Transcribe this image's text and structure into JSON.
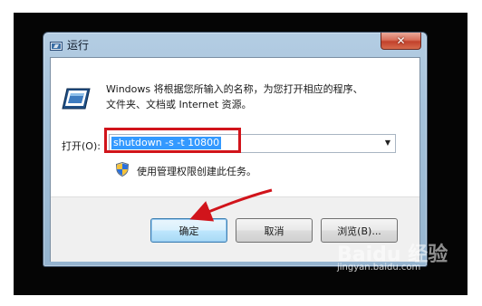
{
  "window": {
    "title": "运行",
    "close_symbol": "✕"
  },
  "description": {
    "line1": "Windows 将根据您所输入的名称，为您打开相应的程序、",
    "line2": "文件夹、文档或 Internet 资源。"
  },
  "open_field": {
    "label": "打开(O):",
    "value": "shutdown -s -t 10800"
  },
  "admin_note": "使用管理权限创建此任务。",
  "buttons": {
    "ok": "确定",
    "cancel": "取消",
    "browse": "浏览(B)..."
  },
  "watermark": {
    "logo": "Baidu 经验",
    "url": "jingyan.baidu.com"
  },
  "colors": {
    "highlight": "#d1141b",
    "selection": "#3399ff"
  }
}
